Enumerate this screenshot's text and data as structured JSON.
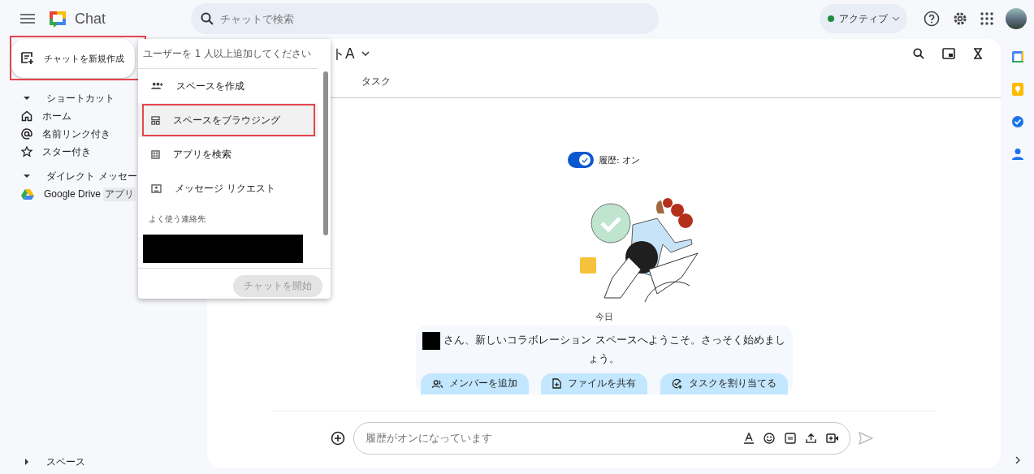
{
  "app": {
    "name": "Chat"
  },
  "search": {
    "placeholder": "チャットで検索"
  },
  "status": {
    "label": "アクティブ",
    "color": "#1e8e3e"
  },
  "new_chat_button": {
    "label": "チャットを新規作成",
    "highlighted": true
  },
  "sidebar": {
    "sections": [
      {
        "label": "ショートカット",
        "expanded": true,
        "items": [
          {
            "label": "ホーム"
          },
          {
            "label": "名前リンク付き"
          },
          {
            "label": "スター付き"
          }
        ]
      },
      {
        "label": "ダイレクト メッセー",
        "expanded": true,
        "items": [
          {
            "label": "Google Drive",
            "badge": "アプリ"
          }
        ]
      }
    ],
    "footer_section": {
      "label": "スペース",
      "expanded": false
    }
  },
  "menu": {
    "hint": "ユーザーを 1 人以上追加してください",
    "items": [
      {
        "label": "スペースを作成",
        "highlighted": false
      },
      {
        "label": "スペースをブラウジング",
        "highlighted": true
      },
      {
        "label": "アプリを検索",
        "highlighted": false
      },
      {
        "label": "メッセージ リクエスト",
        "highlighted": false
      }
    ],
    "frequent_heading": "よく使う連絡先",
    "start_button": {
      "label": "チャットを開始",
      "disabled": true
    }
  },
  "conversation": {
    "title": "トA",
    "tabs": [
      {
        "label": "タスク",
        "selected": false
      }
    ],
    "history": {
      "label": "履歴: オン",
      "on": true
    },
    "date": "今日",
    "welcome": "さん、新しいコラボレーション スペースへようこそ。さっそく始めましょう。",
    "actions": [
      {
        "label": "メンバーを追加"
      },
      {
        "label": "ファイルを共有"
      },
      {
        "label": "タスクを割り当てる"
      }
    ],
    "composer": {
      "placeholder": "履歴がオンになっています"
    }
  }
}
